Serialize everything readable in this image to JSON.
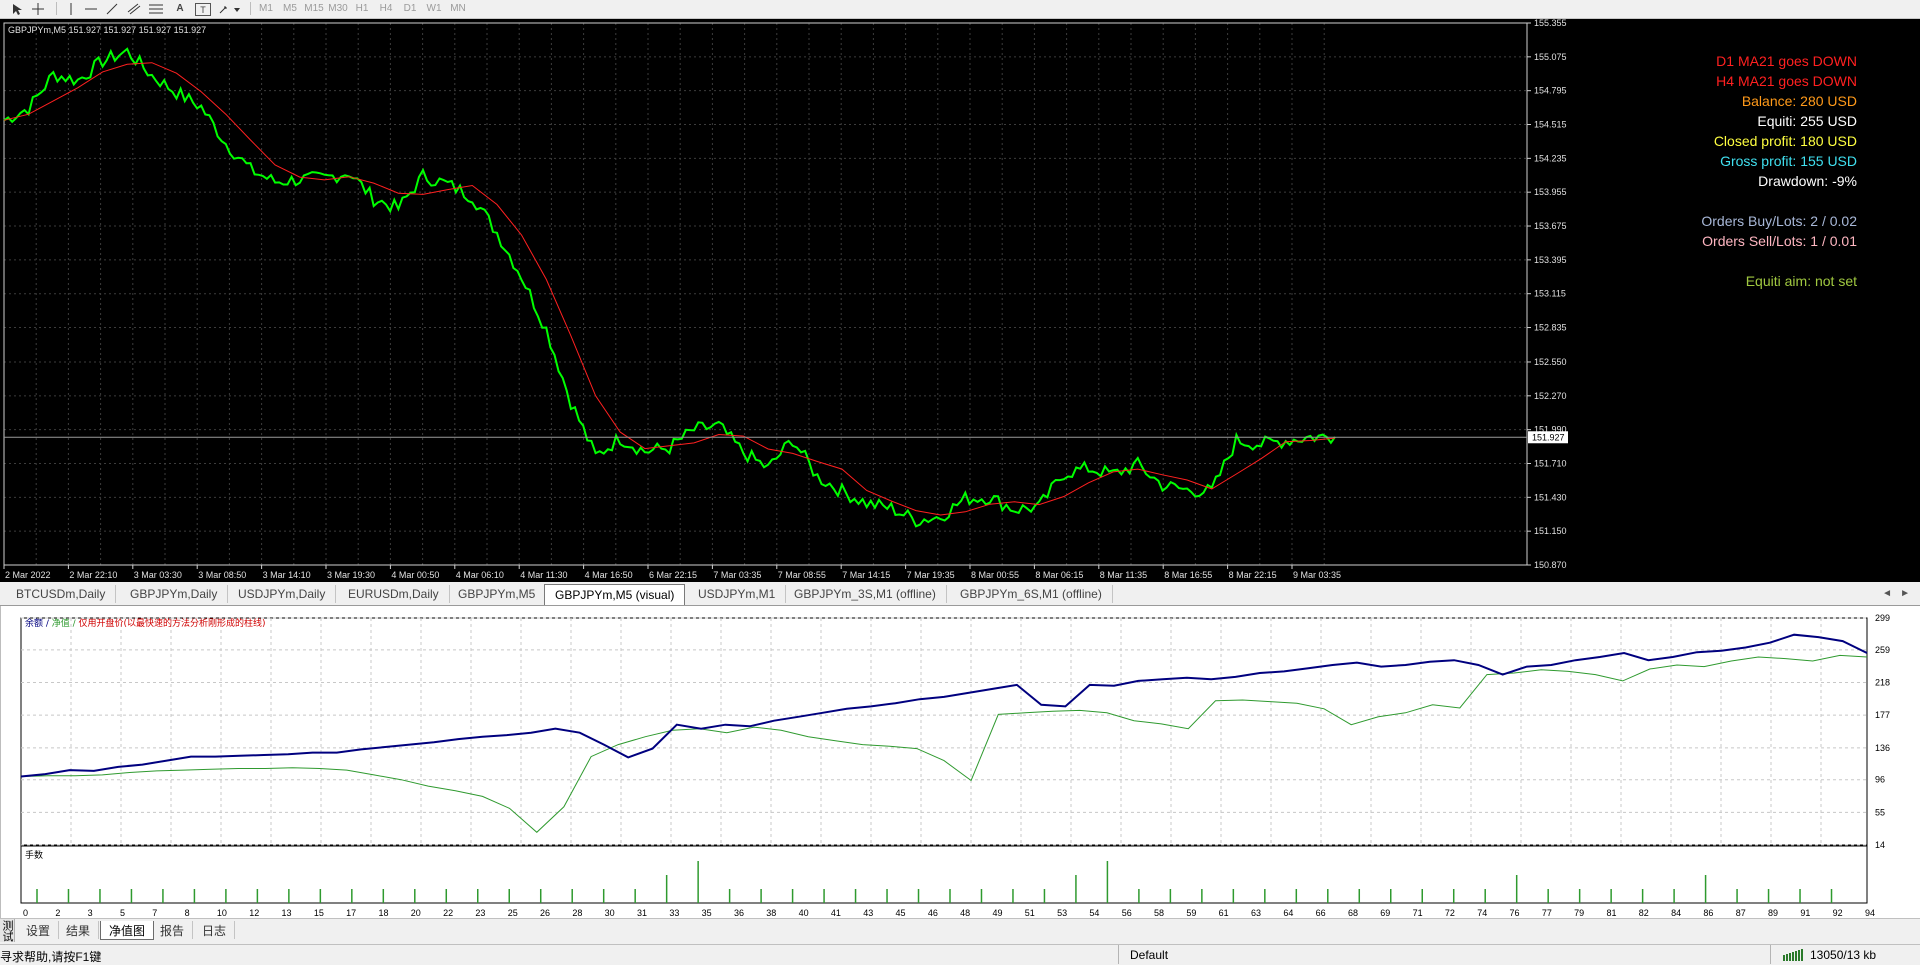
{
  "toolbar": {
    "tool_labels": [
      "A",
      "T"
    ],
    "timeframes": [
      "M1",
      "M5",
      "M15",
      "M30",
      "H1",
      "H4",
      "D1",
      "W1",
      "MN"
    ]
  },
  "main_chart": {
    "header": "GBPJPYm,M5  151.927 151.927 151.927 151.927",
    "current_price": "151.927",
    "price_ticks": [
      "155.355",
      "155.075",
      "154.795",
      "154.515",
      "154.235",
      "153.955",
      "153.675",
      "153.395",
      "153.115",
      "152.835",
      "152.550",
      "152.270",
      "151.990",
      "151.710",
      "151.430",
      "151.150",
      "150.870"
    ],
    "time_ticks": [
      "2 Mar 2022",
      "2 Mar 22:10",
      "3 Mar 03:30",
      "3 Mar 08:50",
      "3 Mar 14:10",
      "3 Mar 19:30",
      "4 Mar 00:50",
      "4 Mar 06:10",
      "4 Mar 11:30",
      "4 Mar 16:50",
      "6 Mar 22:15",
      "7 Mar 03:35",
      "7 Mar 08:55",
      "7 Mar 14:15",
      "7 Mar 19:35",
      "8 Mar 00:55",
      "8 Mar 06:15",
      "8 Mar 11:35",
      "8 Mar 16:55",
      "8 Mar 22:15",
      "9 Mar 03:35"
    ],
    "info": [
      {
        "text": "D1 MA21 goes DOWN",
        "color": "#ff2020"
      },
      {
        "text": "H4 MA21 goes DOWN",
        "color": "#ff2020"
      },
      {
        "text": "Balance: 280 USD",
        "color": "#ff9a1a"
      },
      {
        "text": "Equiti: 255 USD",
        "color": "#ffffff"
      },
      {
        "text": "Closed profit: 180 USD",
        "color": "#ffff40"
      },
      {
        "text": "Gross profit: 155 USD",
        "color": "#40e0f0"
      },
      {
        "text": "Drawdown: -9%",
        "color": "#ffffff"
      },
      {
        "text": "Orders Buy/Lots: 2 / 0.02",
        "color": "#a8b8d8"
      },
      {
        "text": "Orders Sell/Lots: 1 / 0.01",
        "color": "#ffb6c1"
      },
      {
        "text": "Equiti aim: not set",
        "color": "#a0c840"
      }
    ],
    "colors": {
      "price": "#00ff00",
      "ma": "#ff2020",
      "grid": "#3c3c3c"
    }
  },
  "chart_tabs": [
    "BTCUSDm,Daily",
    "GBPJPYm,Daily",
    "USDJPYm,Daily",
    "EURUSDm,Daily",
    "GBPJPYm,M5",
    "GBPJPYm,M5 (visual)",
    "USDJPYm,M1",
    "GBPJPYm_3S,M1 (offline)",
    "GBPJPYm_6S,M1 (offline)"
  ],
  "active_chart_tab": "GBPJPYm,M5 (visual)",
  "equity_graph": {
    "legend": {
      "balance": "余额",
      "equity": "净值",
      "note": "仅用开盘价(以最快速的方法分析刚形成的柱线)"
    },
    "y_ticks": [
      "299",
      "259",
      "218",
      "177",
      "136",
      "96",
      "55",
      "14"
    ],
    "lots_label": "手数",
    "x_ticks": [
      "0",
      "2",
      "3",
      "5",
      "7",
      "8",
      "10",
      "12",
      "13",
      "15",
      "17",
      "18",
      "20",
      "22",
      "23",
      "25",
      "26",
      "28",
      "30",
      "31",
      "33",
      "35",
      "36",
      "38",
      "40",
      "41",
      "43",
      "45",
      "46",
      "48",
      "49",
      "51",
      "53",
      "54",
      "56",
      "58",
      "59",
      "61",
      "63",
      "64",
      "66",
      "68",
      "69",
      "71",
      "72",
      "74",
      "76",
      "77",
      "79",
      "81",
      "82",
      "84",
      "86",
      "87",
      "89",
      "91",
      "92",
      "94"
    ],
    "colors": {
      "balance": "#00007f",
      "equity": "#2f9a2f",
      "lots": "#2f9a2f"
    }
  },
  "chart_data": [
    {
      "type": "line",
      "title": "GBPJPYm,M5",
      "x_start": "2 Mar 2022",
      "x_end": "9 Mar 03:35",
      "ylim": [
        150.87,
        155.355
      ],
      "series": [
        {
          "name": "GBPJPYm",
          "values": [
            154.55,
            154.65,
            154.93,
            154.88,
            155.04,
            155.12,
            154.92,
            154.78,
            154.66,
            154.36,
            154.14,
            154.04,
            154.06,
            154.07,
            154.12,
            153.9,
            153.82,
            154.09,
            154.02,
            153.92,
            153.62,
            153.26,
            152.82,
            152.22,
            151.77,
            151.92,
            151.81,
            151.84,
            151.99,
            152.02,
            151.8,
            151.67,
            151.91,
            151.6,
            151.48,
            151.38,
            151.34,
            151.24,
            151.27,
            151.42,
            151.43,
            151.33,
            151.35,
            151.63,
            151.67,
            151.62,
            151.7,
            151.53,
            151.49,
            151.48,
            151.9,
            151.87,
            151.9,
            151.93,
            151.93
          ]
        }
      ]
    },
    {
      "type": "line",
      "y_ticks": [
        299,
        259,
        218,
        177,
        136,
        96,
        55,
        14
      ],
      "ylim": [
        14,
        299
      ],
      "series": [
        {
          "name": "余额",
          "values": [
            100,
            103,
            108,
            107,
            112,
            115,
            120,
            125,
            125,
            126,
            127,
            128,
            130,
            130,
            134,
            137,
            140,
            143,
            147,
            150,
            152,
            155,
            160,
            155,
            140,
            124,
            135,
            165,
            160,
            165,
            163,
            170,
            175,
            180,
            185,
            188,
            192,
            197,
            200,
            205,
            210,
            215,
            190,
            188,
            215,
            214,
            220,
            222,
            224,
            222,
            225,
            230,
            232,
            236,
            240,
            243,
            238,
            240,
            244,
            246,
            240,
            228,
            238,
            240,
            246,
            250,
            255,
            246,
            250,
            256,
            258,
            262,
            268,
            278,
            275,
            270,
            255
          ]
        },
        {
          "name": "净值",
          "values": [
            100,
            101,
            101,
            102,
            105,
            107,
            108,
            109,
            110,
            110,
            111,
            110,
            108,
            102,
            96,
            88,
            82,
            75,
            60,
            30,
            62,
            125,
            140,
            150,
            158,
            160,
            155,
            162,
            158,
            150,
            145,
            140,
            138,
            135,
            120,
            95,
            178,
            180,
            182,
            183,
            180,
            170,
            166,
            160,
            195,
            196,
            194,
            192,
            185,
            165,
            175,
            180,
            190,
            186,
            228,
            230,
            234,
            232,
            228,
            220,
            235,
            240,
            238,
            245,
            250,
            248,
            245,
            252,
            250
          ]
        }
      ]
    },
    {
      "type": "bar",
      "categories": [
        "0",
        "2",
        "3",
        "5",
        "7",
        "8",
        "10",
        "12",
        "13",
        "15",
        "17",
        "18",
        "20",
        "22",
        "23",
        "25",
        "26",
        "28",
        "30",
        "31",
        "33",
        "35",
        "36",
        "38",
        "40",
        "41",
        "43",
        "45",
        "46",
        "48",
        "49",
        "51",
        "53",
        "54",
        "56",
        "58",
        "59",
        "61",
        "63",
        "64",
        "66",
        "68",
        "69",
        "71",
        "72",
        "74",
        "76",
        "77",
        "79",
        "81",
        "82",
        "84",
        "86",
        "87",
        "89",
        "91",
        "92",
        "94"
      ],
      "values": [
        1,
        1,
        1,
        1,
        1,
        1,
        1,
        1,
        1,
        1,
        1,
        1,
        1,
        1,
        1,
        1,
        1,
        1,
        1,
        1,
        2,
        3,
        1,
        1,
        1,
        1,
        1,
        1,
        1,
        1,
        1,
        1,
        1,
        2,
        3,
        1,
        1,
        1,
        1,
        1,
        1,
        1,
        1,
        1,
        1,
        1,
        1,
        2,
        1,
        1,
        1,
        1,
        1,
        2,
        1,
        1,
        1,
        1
      ]
    }
  ],
  "bottom_tabs": [
    "设置",
    "结果",
    "净值图",
    "报告",
    "日志"
  ],
  "active_bottom_tab": "净值图",
  "side_label": "测试",
  "status": {
    "help": "寻求帮助,请按F1键",
    "profile": "Default",
    "traffic": "13050/13 kb"
  }
}
